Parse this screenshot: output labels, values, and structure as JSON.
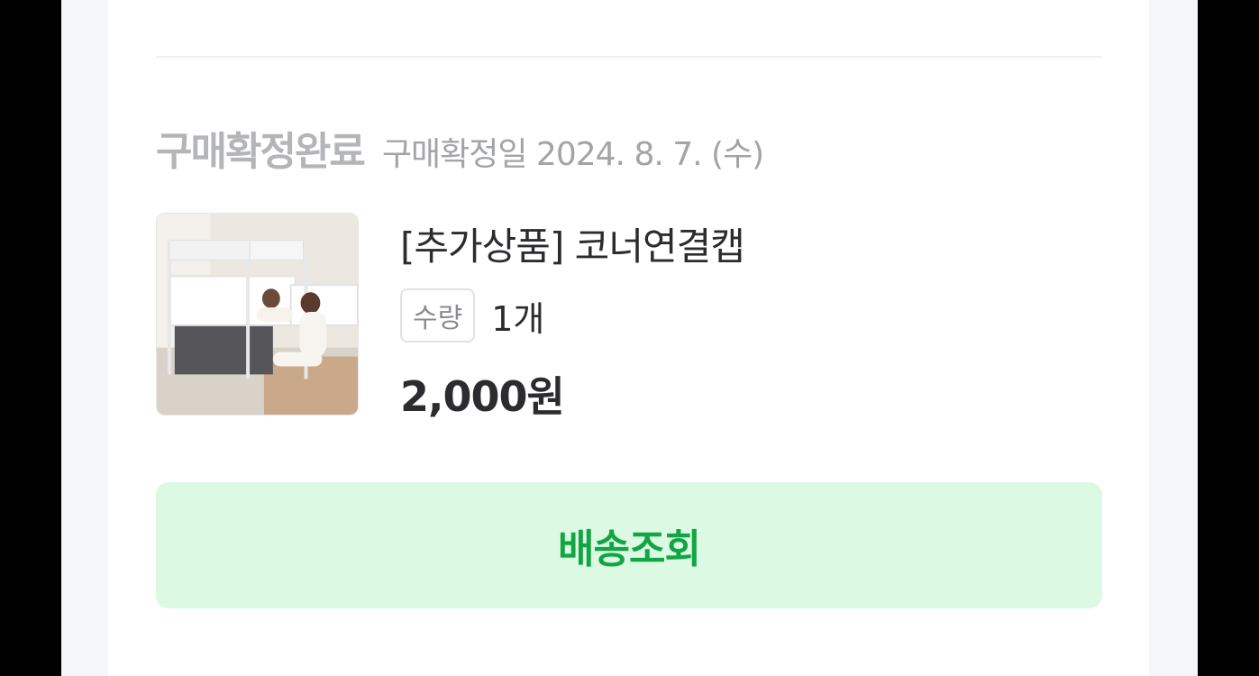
{
  "order": {
    "status_title": "구매확정완료",
    "confirm_date": "구매확정일 2024. 8. 7. (수)"
  },
  "product": {
    "image_icon": "bed-guard-product-photo",
    "name": "[추가상품] 코너연결캡",
    "quantity_label": "수량",
    "quantity_value": "1개",
    "price": "2,000원"
  },
  "actions": {
    "track_delivery_label": "배송조회"
  },
  "colors": {
    "button_bg": "#dcf9e3",
    "button_text": "#13a544",
    "status_text": "#b4b5b8"
  }
}
